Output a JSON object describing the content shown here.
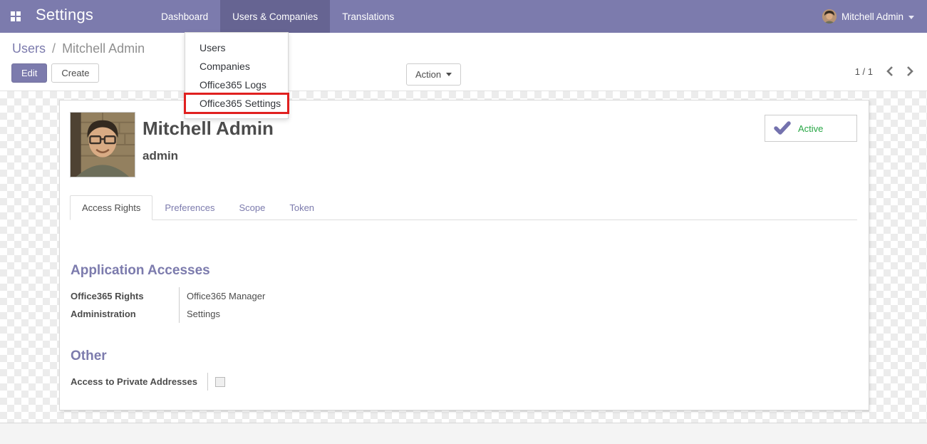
{
  "navbar": {
    "brand": "Settings",
    "items": [
      {
        "label": "Dashboard",
        "active": false
      },
      {
        "label": "Users & Companies",
        "active": true
      },
      {
        "label": "Translations",
        "active": false
      }
    ],
    "user": {
      "name": "Mitchell Admin"
    }
  },
  "dropdown": {
    "items": [
      {
        "label": "Users",
        "highlighted": false
      },
      {
        "label": "Companies",
        "highlighted": false
      },
      {
        "label": "Office365 Logs",
        "highlighted": false
      },
      {
        "label": "Office365 Settings",
        "highlighted": true
      }
    ]
  },
  "control_panel": {
    "breadcrumb": {
      "parent": "Users",
      "separator": "/",
      "current": "Mitchell Admin"
    },
    "buttons": {
      "edit": "Edit",
      "create": "Create",
      "action": "Action"
    },
    "pager": {
      "value": "1 / 1"
    }
  },
  "form": {
    "name": "Mitchell Admin",
    "login": "admin",
    "status": {
      "label": "Active"
    },
    "tabs": [
      {
        "label": "Access Rights",
        "active": true
      },
      {
        "label": "Preferences",
        "active": false
      },
      {
        "label": "Scope",
        "active": false
      },
      {
        "label": "Token",
        "active": false
      }
    ],
    "sections": [
      {
        "title": "Application Accesses",
        "fields": [
          {
            "label": "Office365 Rights",
            "value": "Office365 Manager"
          },
          {
            "label": "Administration",
            "value": "Settings"
          }
        ]
      },
      {
        "title": "Other",
        "fields": [
          {
            "label": "Access to Private Addresses",
            "value": "",
            "checkbox": true,
            "checked": false
          }
        ]
      }
    ]
  },
  "colors": {
    "navbar_bg": "#7c7bad",
    "navbar_active_bg": "#666492",
    "accent": "#7c7bad",
    "highlight_red": "#e0201f",
    "active_green": "#28a745",
    "checkmark_purple": "#7472ae"
  }
}
